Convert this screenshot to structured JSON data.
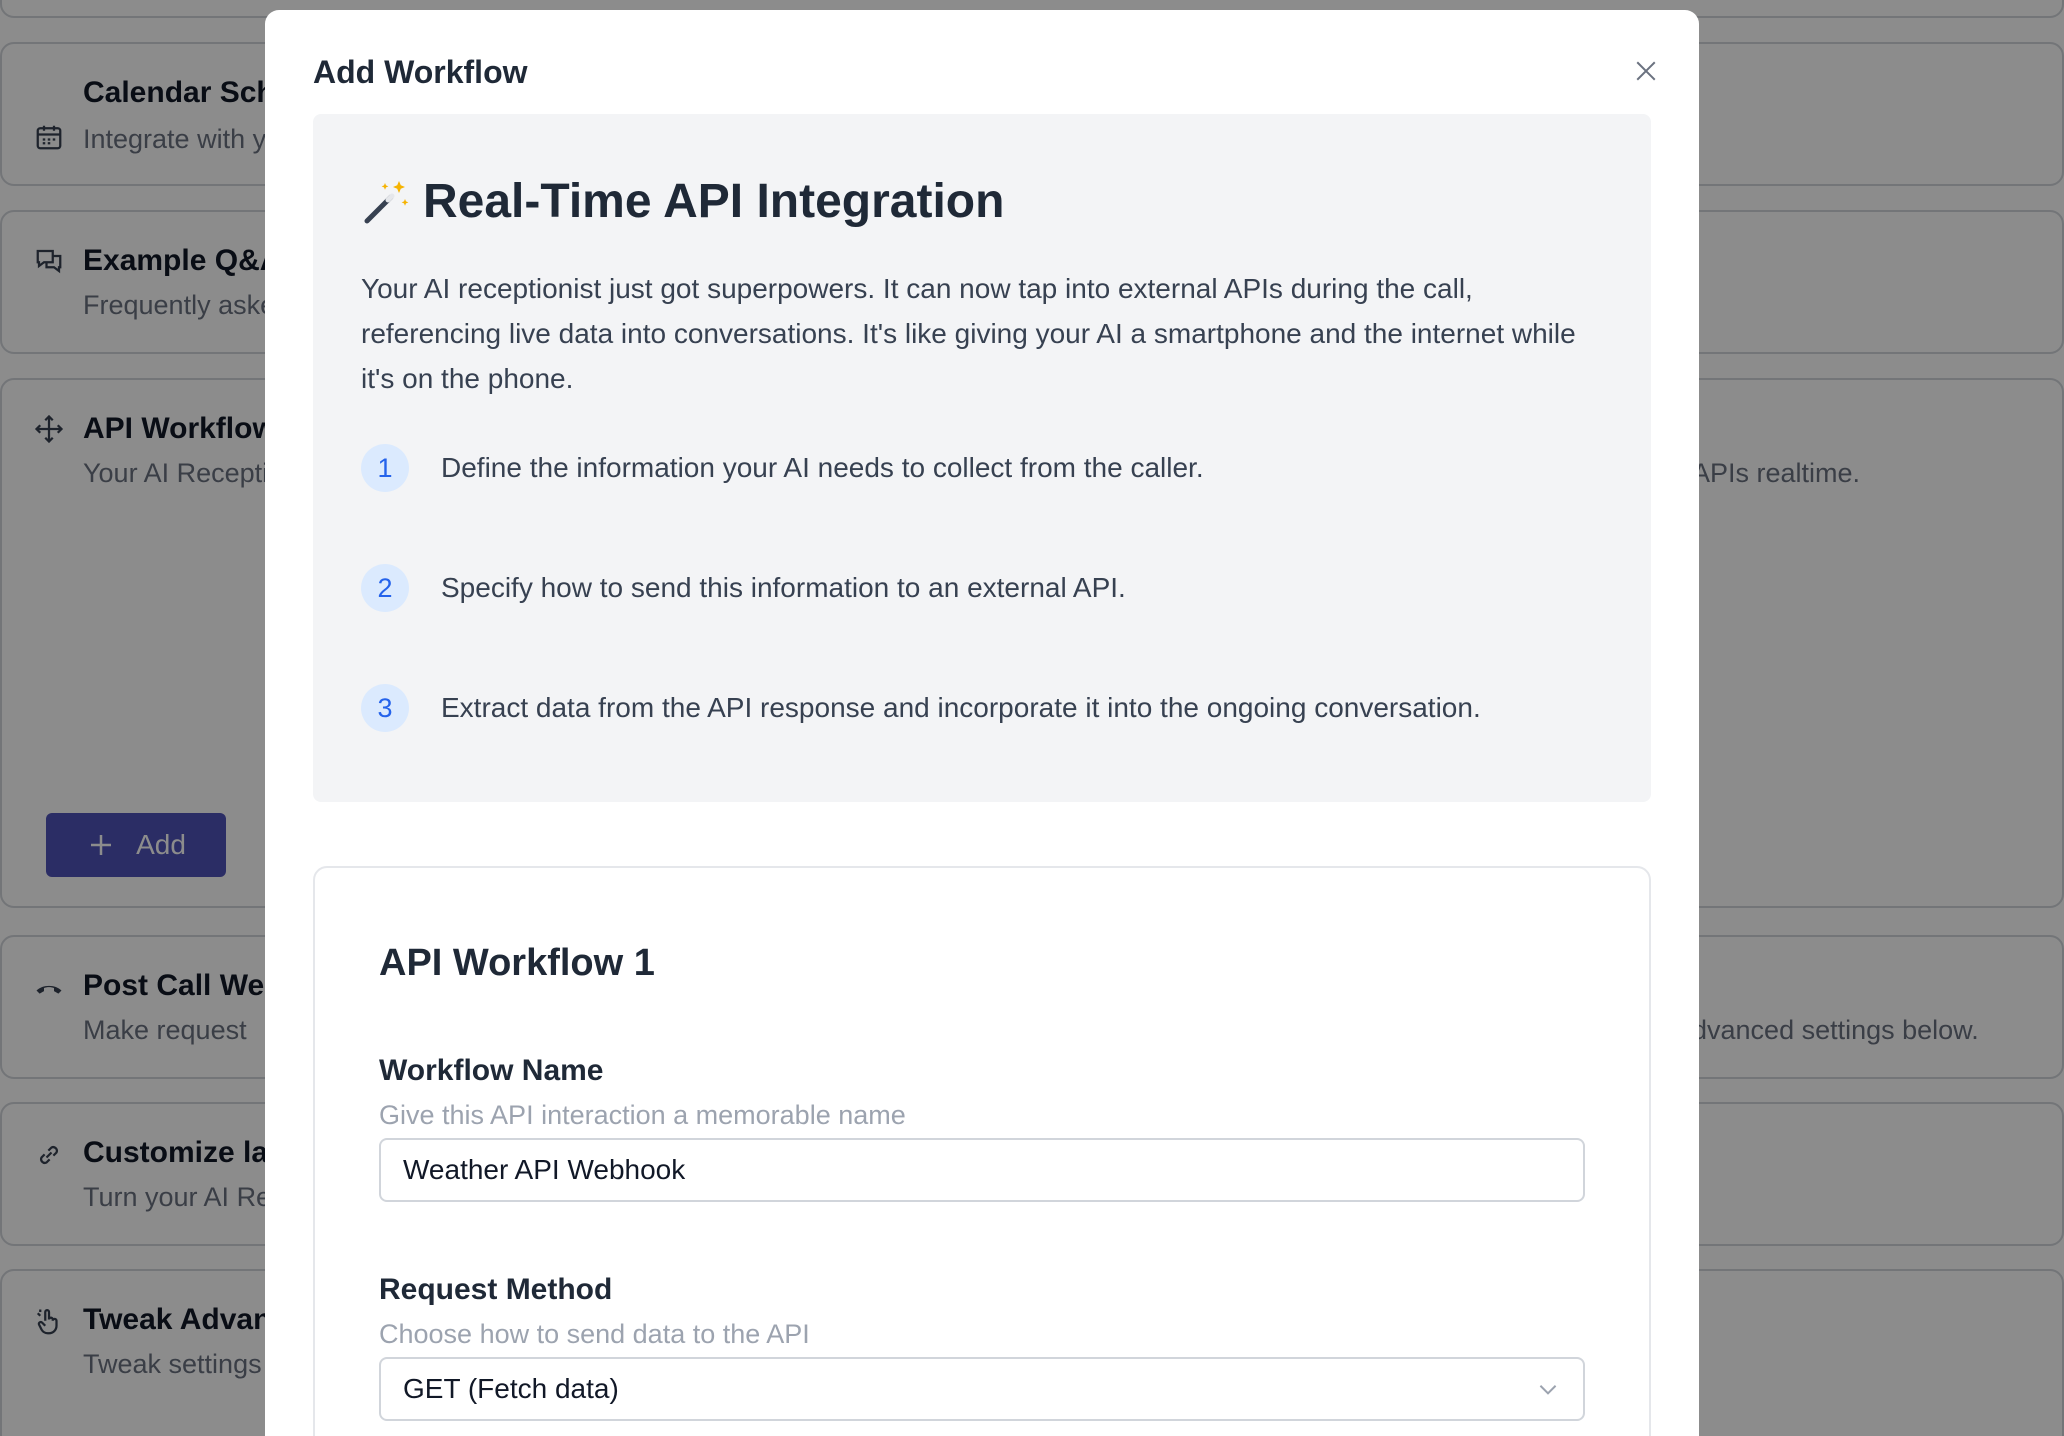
{
  "background": {
    "cards": [
      {
        "title": "Calendar Scheduling",
        "description": "Integrate with your calendar",
        "right_text": "",
        "icon": "calendar-icon"
      },
      {
        "title": "Example Q&A",
        "description": "Frequently asked questions",
        "right_text": "",
        "icon": "chat-bubbles-icon"
      },
      {
        "title": "API Workflows",
        "description": "Your AI Receptionist can",
        "right_text": "APIs realtime.",
        "icon": "move-arrows-icon"
      },
      {
        "title": "Post Call Webhook",
        "description": "Make request",
        "right_text": "dvanced settings below.",
        "icon": "phone-hangup-icon"
      },
      {
        "title": "Customize language",
        "description": "Turn your AI Receptionist",
        "right_text": "",
        "icon": "link-icon"
      },
      {
        "title": "Tweak Advanced",
        "description": "Tweak settings",
        "right_text": "",
        "icon": "pointer-click-icon"
      }
    ],
    "add_button": {
      "label": "Add",
      "color": "#4f52b8"
    }
  },
  "modal": {
    "title": "Add Workflow",
    "intro": {
      "emoji": "magic-wand-icon",
      "heading": "Real-Time API Integration",
      "paragraph": "Your AI receptionist just got superpowers. It can now tap into external APIs during the call, referencing live data into conversations. It's like giving your AI a smartphone and the internet while it's on the phone.",
      "steps": [
        {
          "number": "1",
          "text": "Define the information your AI needs to collect from the caller."
        },
        {
          "number": "2",
          "text": "Specify how to send this information to an external API."
        },
        {
          "number": "3",
          "text": "Extract data from the API response and incorporate it into the ongoing conversation."
        }
      ]
    },
    "workflow": {
      "title": "API Workflow 1",
      "name_field": {
        "label": "Workflow Name",
        "help": "Give this API interaction a memorable name",
        "value": "Weather API Webhook"
      },
      "method_field": {
        "label": "Request Method",
        "help": "Choose how to send data to the API",
        "selected": "GET (Fetch data)"
      }
    }
  }
}
